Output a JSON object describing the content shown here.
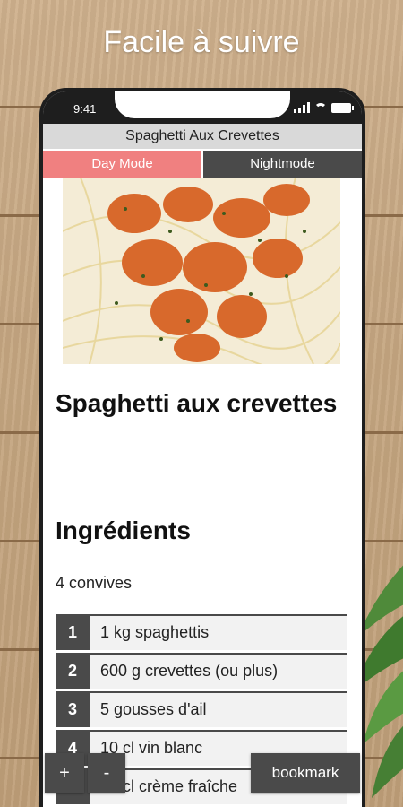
{
  "promo": {
    "headline": "Facile à suivre"
  },
  "status_bar": {
    "time": "9:41",
    "icons": [
      "signal-icon",
      "wifi-icon",
      "battery-icon"
    ]
  },
  "app": {
    "title": "Spaghetti Aux Crevettes",
    "modes": {
      "day_label": "Day Mode",
      "night_label": "Nightmode",
      "active": "day"
    }
  },
  "recipe": {
    "title": "Spaghetti aux crevettes",
    "ingredients_heading": "Ingrédients",
    "servings": "4 convives",
    "ingredients": [
      {
        "num": "1",
        "text": "1 kg spaghettis"
      },
      {
        "num": "2",
        "text": "600 g crevettes (ou plus)"
      },
      {
        "num": "3",
        "text": "5 gousses d'ail"
      },
      {
        "num": "4",
        "text": "10 cl vin blanc"
      },
      {
        "num": "5",
        "text": "20 cl crème fraîche"
      }
    ]
  },
  "controls": {
    "plus_label": "+",
    "minus_label": "-",
    "bookmark_label": "bookmark"
  },
  "colors": {
    "day_mode": "#f08080",
    "dark": "#4a4a4a",
    "title_bar": "#d9d9d9"
  }
}
